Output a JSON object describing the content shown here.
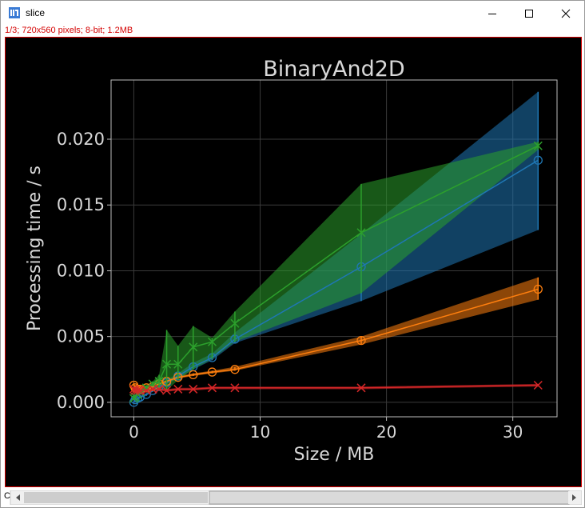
{
  "window": {
    "title": "slice",
    "subtitle": "1/3; 720x560 pixels; 8-bit; 1.2MB",
    "minimize_icon": "minimize-icon",
    "maximize_icon": "maximize-icon",
    "close_icon": "close-icon",
    "status_char": "C"
  },
  "colors": {
    "blue": "#1f77b4",
    "orange": "#ff7f0e",
    "green": "#2ca02c",
    "red": "#d62728",
    "background": "#000000",
    "text": "#d8d8d8"
  },
  "chart_data": {
    "type": "line",
    "title": "BinaryAnd2D",
    "xlabel": "Size / MB",
    "ylabel": "Processing time / s",
    "xlim": [
      -1.8,
      33.5
    ],
    "ylim": [
      -0.0011,
      0.0245
    ],
    "x_ticks": [
      0,
      10,
      20,
      30
    ],
    "x_tick_labels": [
      "0",
      "10",
      "20",
      "30"
    ],
    "y_ticks": [
      0.0,
      0.005,
      0.01,
      0.015,
      0.02
    ],
    "y_tick_labels": [
      "0.000",
      "0.005",
      "0.010",
      "0.015",
      "0.020"
    ],
    "grid": true,
    "series": [
      {
        "color": "#1f77b4",
        "marker": "o",
        "x": [
          0.0,
          0.1,
          0.3,
          0.5,
          1.0,
          1.5,
          2.0,
          2.6,
          3.5,
          4.7,
          6.2,
          8.0,
          18.0,
          32.0
        ],
        "y": [
          0.0,
          0.0002,
          0.0003,
          0.0004,
          0.0006,
          0.0009,
          0.0012,
          0.0015,
          0.002,
          0.0027,
          0.0034,
          0.0048,
          0.0103,
          0.0184
        ],
        "lower": [
          -0.0001,
          0.0001,
          0.0002,
          0.0003,
          0.0005,
          0.0008,
          0.0011,
          0.0014,
          0.0018,
          0.0025,
          0.0032,
          0.0045,
          0.0077,
          0.0131
        ],
        "upper": [
          0.0001,
          0.0003,
          0.0004,
          0.0005,
          0.0007,
          0.001,
          0.0013,
          0.0017,
          0.0022,
          0.003,
          0.0037,
          0.0053,
          0.0128,
          0.0236
        ]
      },
      {
        "color": "#ff7f0e",
        "marker": "o",
        "x": [
          0.0,
          0.1,
          0.3,
          0.5,
          1.0,
          1.5,
          2.0,
          2.6,
          3.5,
          4.7,
          6.2,
          8.0,
          18.0,
          32.0
        ],
        "y": [
          0.0013,
          0.0011,
          0.001,
          0.001,
          0.0011,
          0.0012,
          0.0014,
          0.0016,
          0.0019,
          0.0021,
          0.0023,
          0.0025,
          0.0047,
          0.0086
        ],
        "lower": [
          0.0011,
          0.0009,
          0.0009,
          0.0009,
          0.001,
          0.0011,
          0.0013,
          0.0015,
          0.0018,
          0.002,
          0.0022,
          0.0024,
          0.0044,
          0.0078
        ],
        "upper": [
          0.0015,
          0.0013,
          0.0012,
          0.0012,
          0.0013,
          0.0014,
          0.0015,
          0.0017,
          0.002,
          0.0022,
          0.0024,
          0.0027,
          0.005,
          0.0095
        ]
      },
      {
        "color": "#2ca02c",
        "marker": "x",
        "x": [
          0.0,
          0.1,
          0.3,
          0.5,
          1.0,
          1.5,
          2.0,
          2.6,
          3.5,
          4.7,
          6.2,
          8.0,
          18.0,
          32.0
        ],
        "y": [
          0.0003,
          0.0004,
          0.0006,
          0.0008,
          0.0011,
          0.0014,
          0.0016,
          0.0029,
          0.0029,
          0.0042,
          0.0046,
          0.006,
          0.0129,
          0.0195
        ],
        "lower": [
          0.0002,
          0.0003,
          0.0005,
          0.0006,
          0.0009,
          0.0012,
          0.0011,
          0.0009,
          0.0017,
          0.0025,
          0.0033,
          0.0046,
          0.0083,
          0.0192
        ],
        "upper": [
          0.0005,
          0.0006,
          0.0008,
          0.001,
          0.0013,
          0.0016,
          0.0021,
          0.0055,
          0.0043,
          0.0058,
          0.0049,
          0.0069,
          0.0166,
          0.0198
        ]
      },
      {
        "color": "#d62728",
        "marker": "x",
        "x": [
          0.0,
          0.1,
          0.3,
          0.5,
          1.0,
          1.5,
          2.0,
          2.6,
          3.5,
          4.7,
          6.2,
          8.0,
          18.0,
          32.0
        ],
        "y": [
          0.001,
          0.0009,
          0.0009,
          0.0009,
          0.0009,
          0.001,
          0.001,
          0.0009,
          0.001,
          0.001,
          0.0011,
          0.0011,
          0.0011,
          0.0013
        ],
        "lower": [
          0.0008,
          0.0007,
          0.0008,
          0.0008,
          0.0008,
          0.0009,
          0.0009,
          0.0008,
          0.0009,
          0.0009,
          0.001,
          0.001,
          0.001,
          0.0012
        ],
        "upper": [
          0.0012,
          0.0011,
          0.001,
          0.001,
          0.001,
          0.0011,
          0.0011,
          0.001,
          0.0011,
          0.0011,
          0.0012,
          0.0012,
          0.0012,
          0.0014
        ]
      }
    ]
  }
}
